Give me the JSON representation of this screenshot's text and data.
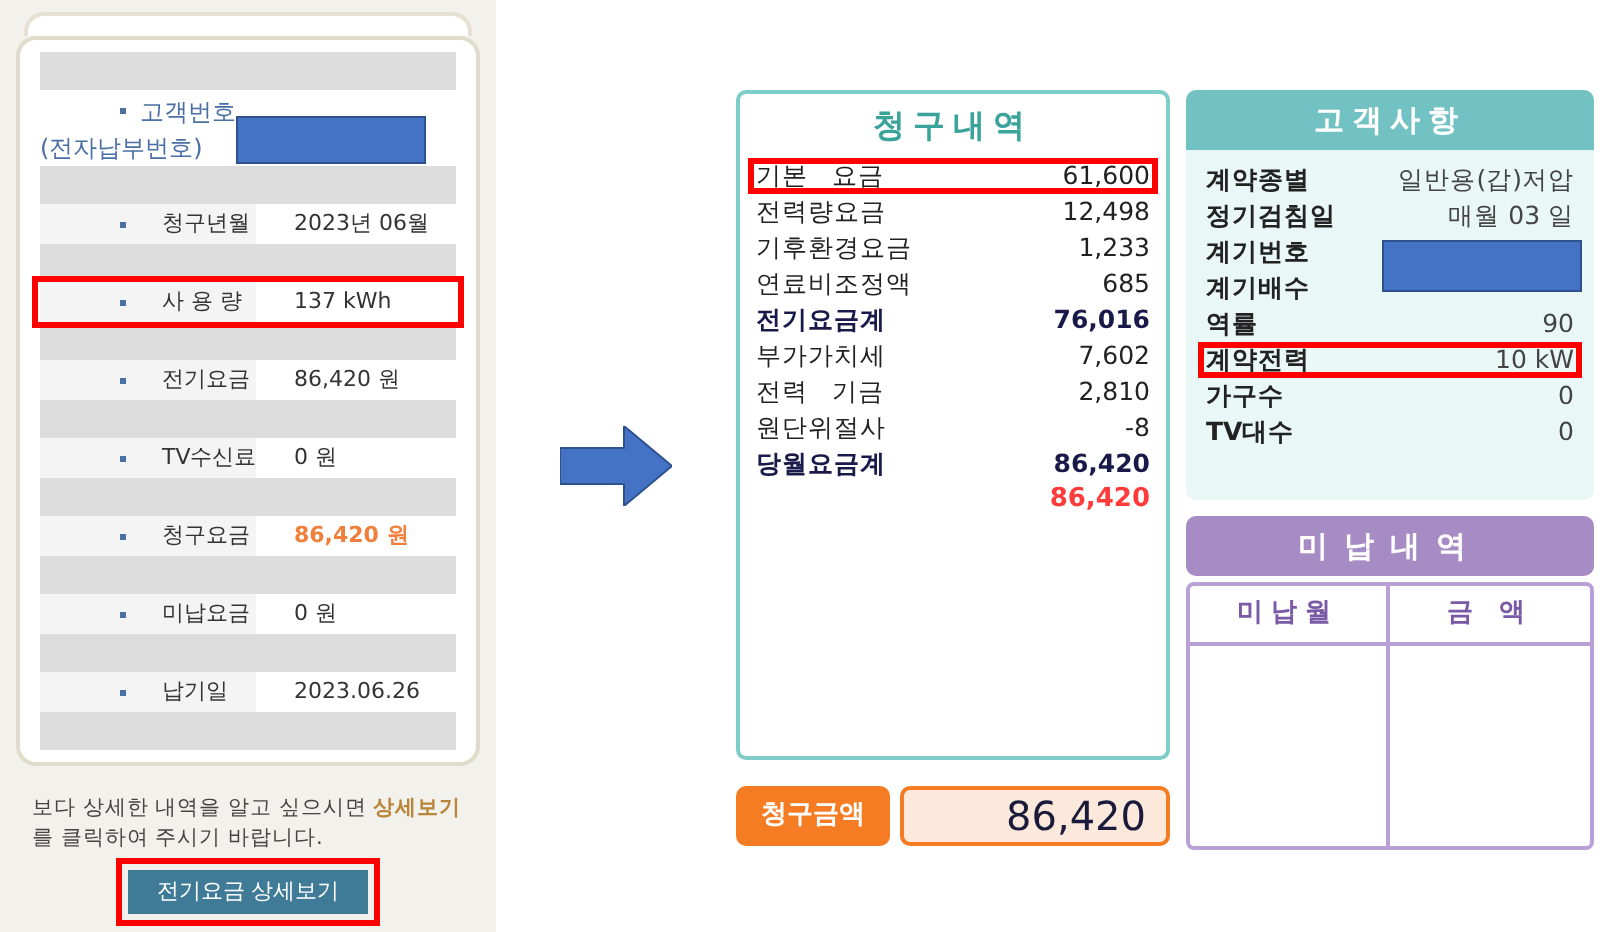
{
  "left": {
    "customer_number": {
      "label": "고객번호",
      "sublabel": "(전자납부번호)",
      "redacted": true
    },
    "rows": [
      {
        "label": "청구년월",
        "value": "2023년 06월",
        "emphasis": false,
        "highlighted": false
      },
      {
        "label": "사 용 량",
        "value": "137 kWh",
        "emphasis": false,
        "highlighted": true
      },
      {
        "label": "전기요금",
        "value": "86,420 원",
        "emphasis": false,
        "highlighted": false
      },
      {
        "label": "TV수신료",
        "value": "0 원",
        "emphasis": false,
        "highlighted": false
      },
      {
        "label": "청구요금",
        "value": "86,420 원",
        "emphasis": true,
        "highlighted": false
      },
      {
        "label": "미납요금",
        "value": "0 원",
        "emphasis": false,
        "highlighted": false
      },
      {
        "label": "납기일",
        "value": "2023.06.26",
        "emphasis": false,
        "highlighted": false
      }
    ],
    "note": "보다 상세한 내역을 알고 싶으시면 **상세보기**를 클릭하여 주시기 바랍니다.",
    "button": {
      "label": "전기요금 상세보기",
      "highlighted": true
    }
  },
  "billing": {
    "title": "청구내역",
    "rows": [
      {
        "label": "기본   요금",
        "value": "61,600",
        "kind": "item",
        "highlighted": true
      },
      {
        "label": "전력량요금",
        "value": "12,498",
        "kind": "item",
        "highlighted": false
      },
      {
        "label": "기후환경요금",
        "value": "1,233",
        "kind": "item",
        "highlighted": false
      },
      {
        "label": "연료비조정액",
        "value": "685",
        "kind": "item",
        "highlighted": false
      },
      {
        "label": "전기요금계",
        "value": "76,016",
        "kind": "subtotal",
        "highlighted": false
      },
      {
        "label": "부가가치세",
        "value": "7,602",
        "kind": "item",
        "highlighted": false
      },
      {
        "label": "전력   기금",
        "value": "2,810",
        "kind": "item",
        "highlighted": false
      },
      {
        "label": "원단위절사",
        "value": "-8",
        "kind": "item",
        "highlighted": false
      },
      {
        "label": "당월요금계",
        "value": "86,420",
        "kind": "subtotal",
        "highlighted": false
      }
    ],
    "grand_total": "86,420",
    "claim": {
      "label": "청구금액",
      "value": "86,420"
    }
  },
  "customer": {
    "title": "고객사항",
    "rows": [
      {
        "label": "계약종별",
        "value": "일반용(갑)저압",
        "highlighted": false
      },
      {
        "label": "정기검침일",
        "value": "매월 03 일",
        "highlighted": false
      },
      {
        "label": "계기번호",
        "redacted": true,
        "highlighted": false
      },
      {
        "label": "계기배수",
        "highlighted": false
      },
      {
        "label": "역률",
        "value": "90",
        "highlighted": false
      },
      {
        "label": "계약전력",
        "value": "10 kW",
        "highlighted": true
      },
      {
        "label": "가구수",
        "value": "0",
        "highlighted": false
      },
      {
        "label": "TV대수",
        "value": "0",
        "highlighted": false
      }
    ]
  },
  "unpaid": {
    "title": "미납내역",
    "columns": [
      "미납월",
      "금 액"
    ]
  }
}
